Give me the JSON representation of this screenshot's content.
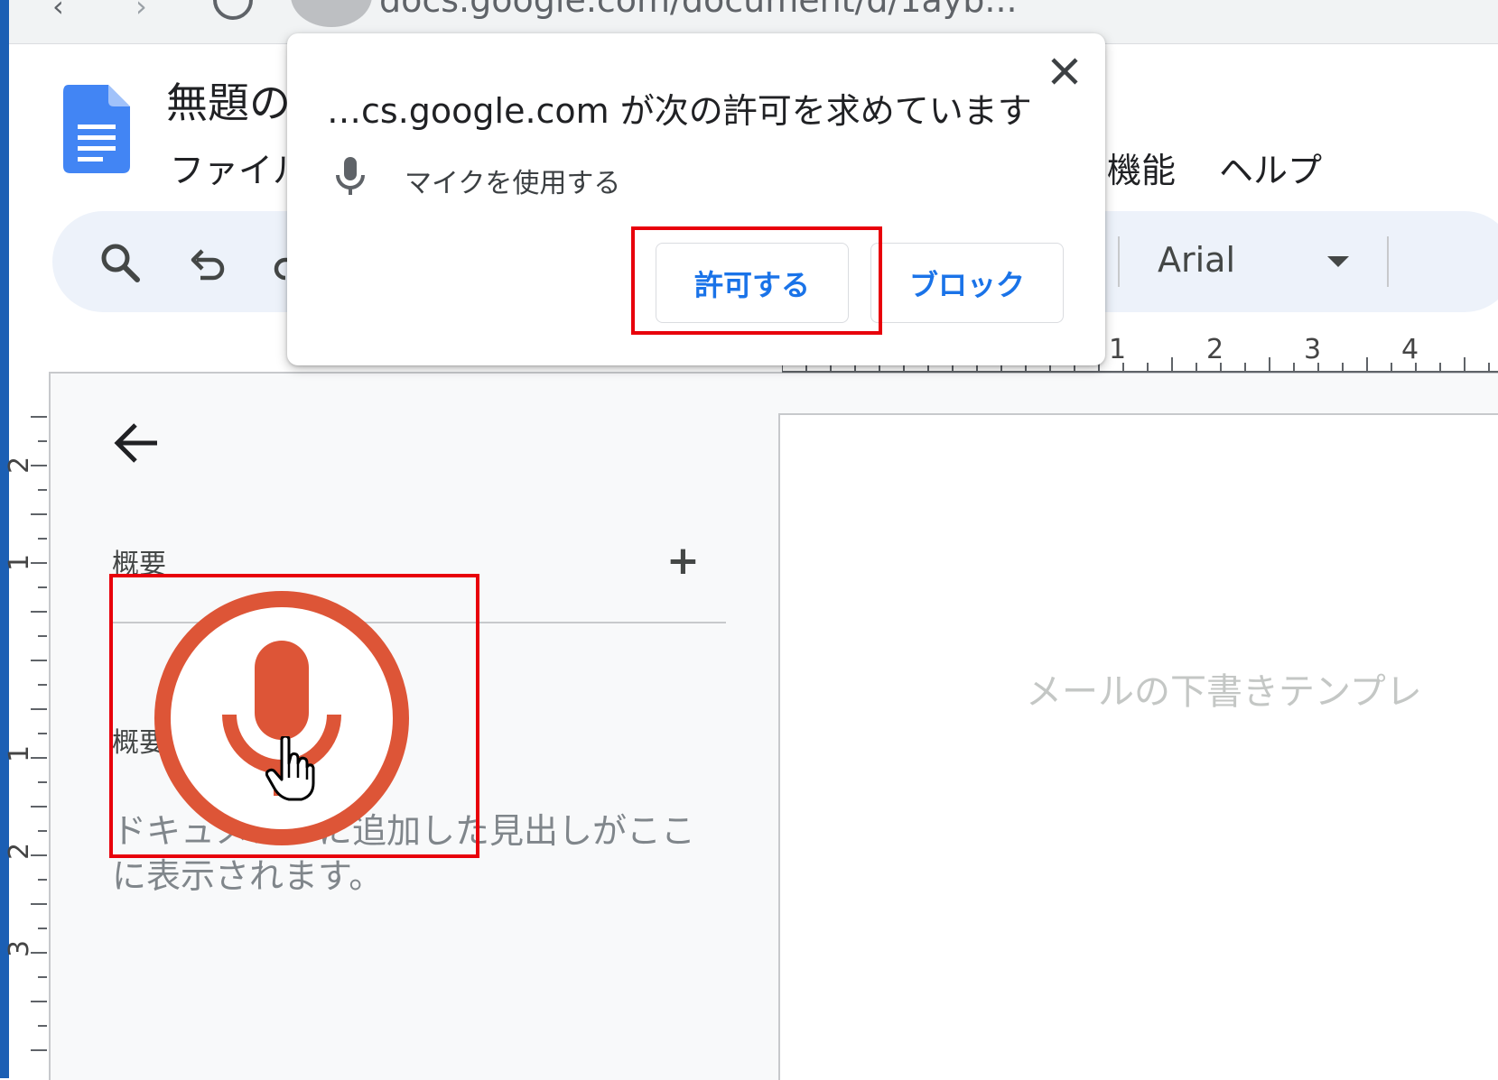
{
  "browser": {
    "url": "docs.google.com/document/d/1ayb..."
  },
  "docs": {
    "title": "無題の",
    "menu": {
      "file": "ファイル",
      "tools": "機能",
      "help": "ヘルプ"
    },
    "toolbar": {
      "font_name": "Arial"
    },
    "ruler": {
      "horizontal": [
        "1",
        "2",
        "3",
        "4"
      ],
      "vertical": [
        "2",
        "1",
        "1",
        "2",
        "3"
      ]
    },
    "outline": {
      "label": "概要",
      "summary_label": "概要",
      "hint": "ドキュメントに追加した見出しがここに表示されます。"
    },
    "page": {
      "placeholder": "メールの下書きテンプレ"
    }
  },
  "permission_popup": {
    "title": "…cs.google.com が次の許可を求めています",
    "permission": "マイクを使用する",
    "allow_label": "許可する",
    "block_label": "ブロック"
  },
  "colors": {
    "accent_blue": "#1a73e8",
    "highlight_red": "#e8000b",
    "mic_red": "#dd5537",
    "docs_blue": "#4285f4"
  }
}
